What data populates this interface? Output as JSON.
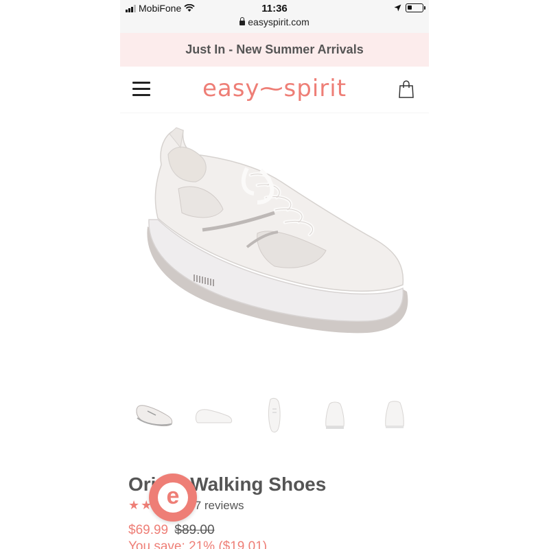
{
  "status_bar": {
    "carrier": "MobiFone",
    "time": "11:36",
    "url": "easyspirit.com"
  },
  "promo": {
    "text": "Just In - New Summer Arrivals"
  },
  "header": {
    "logo_left": "easy",
    "logo_sep": "⁓",
    "logo_right": "spirit"
  },
  "product": {
    "title": "Origin Walking Shoes",
    "rating_stars": 5,
    "reviews": "7 reviews",
    "price": "$69.99",
    "old_price": "$89.00",
    "savings": "You save: 21% ($19.01)"
  },
  "thumbnails": [
    "angle-view",
    "side-view",
    "top-view",
    "front-view",
    "back-view"
  ],
  "chat_badge": {
    "letter": "e"
  },
  "colors": {
    "accent": "#ee7e76",
    "promo_bg": "#fcecec"
  }
}
